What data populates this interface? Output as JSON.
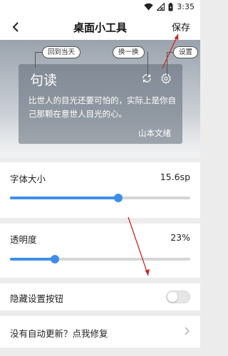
{
  "status_bar": {
    "time": "3:35"
  },
  "header": {
    "title": "桌面小工具",
    "back_icon": "chevron-left-icon",
    "save_label": "保存"
  },
  "hero": {
    "tooltips": {
      "today": "回到当天",
      "swap": "换一换",
      "settings": "设置"
    },
    "card": {
      "title": "句读",
      "quote": "比世人的目光还要可怕的，实际上是你自己那颗在意世人目光的心。",
      "author": "山本文绪",
      "icons": [
        "refresh-icon",
        "settings-icon"
      ]
    }
  },
  "font_size": {
    "label": "字体大小",
    "value": "15.6sp",
    "slider_fraction": 0.6
  },
  "transparency": {
    "label": "透明度",
    "value": "23%",
    "slider_fraction": 0.25
  },
  "hide_settings": {
    "label": "隐藏设置按钮",
    "enabled": false
  },
  "repair": {
    "label": "没有自动更新？点我修复"
  },
  "colors": {
    "accent": "#3e8ee8",
    "annotation": "#c62828"
  }
}
